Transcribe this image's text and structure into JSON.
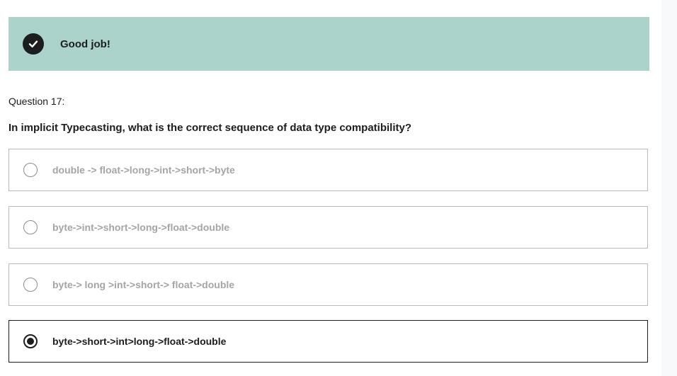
{
  "banner": {
    "icon": "check-circle-icon",
    "text": "Good job!",
    "background": "#acd2cc"
  },
  "question": {
    "number_label": "Question 17:",
    "text": "In implicit Typecasting, what is the correct sequence of data type compatibility?"
  },
  "options": [
    {
      "label": "double -> float->long->int->short->byte",
      "selected": false
    },
    {
      "label": "byte->int->short->long->float->double",
      "selected": false
    },
    {
      "label": "byte-> long >int->short-> float->double",
      "selected": false
    },
    {
      "label": "byte->short->int>long->float->double",
      "selected": true
    }
  ],
  "colors": {
    "text_dark": "#1c1d1f",
    "text_muted": "#a3a6a9",
    "border": "#b8bcbf"
  }
}
